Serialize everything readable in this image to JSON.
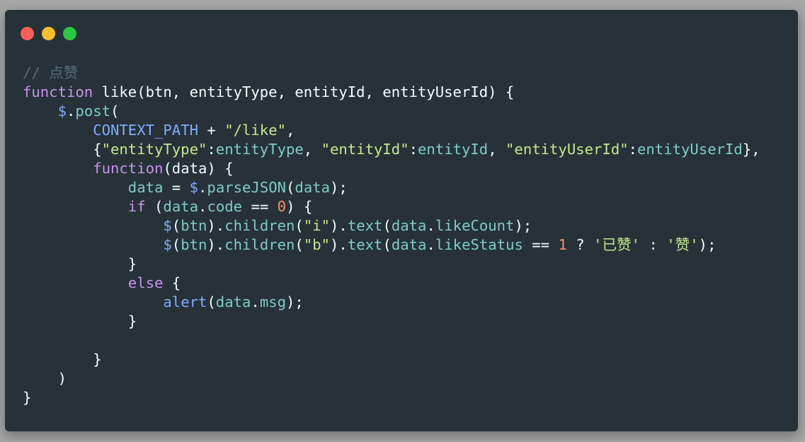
{
  "window": {
    "dots": [
      "close",
      "minimize",
      "maximize"
    ]
  },
  "colors": {
    "background": "#263238",
    "comment": "#546e7a",
    "keyword": "#c792ea",
    "function": "#82aaff",
    "string": "#c3e88d",
    "number": "#f78c6c",
    "property": "#80cbc4",
    "plain": "#eeffff"
  },
  "code": {
    "lines": [
      [
        [
          "comment",
          "// 点赞"
        ]
      ],
      [
        [
          "keyword",
          "function"
        ],
        [
          "plain",
          " like(btn, entityType, entityId, entityUserId) {"
        ]
      ],
      [
        [
          "plain",
          "    "
        ],
        [
          "fn",
          "$"
        ],
        [
          "plain",
          "."
        ],
        [
          "prop",
          "post"
        ],
        [
          "plain",
          "("
        ]
      ],
      [
        [
          "plain",
          "        "
        ],
        [
          "const",
          "CONTEXT_PATH"
        ],
        [
          "plain",
          " + "
        ],
        [
          "string",
          "\"/like\""
        ],
        [
          "plain",
          ","
        ]
      ],
      [
        [
          "plain",
          "        {"
        ],
        [
          "string",
          "\"entityType\""
        ],
        [
          "plain",
          ":"
        ],
        [
          "prop",
          "entityType"
        ],
        [
          "plain",
          ", "
        ],
        [
          "string",
          "\"entityId\""
        ],
        [
          "plain",
          ":"
        ],
        [
          "prop",
          "entityId"
        ],
        [
          "plain",
          ", "
        ],
        [
          "string",
          "\"entityUserId\""
        ],
        [
          "plain",
          ":"
        ],
        [
          "prop",
          "entityUserId"
        ],
        [
          "plain",
          "},"
        ]
      ],
      [
        [
          "plain",
          "        "
        ],
        [
          "keyword",
          "function"
        ],
        [
          "plain",
          "(data) {"
        ]
      ],
      [
        [
          "plain",
          "            "
        ],
        [
          "prop",
          "data"
        ],
        [
          "plain",
          " = "
        ],
        [
          "fn",
          "$"
        ],
        [
          "plain",
          "."
        ],
        [
          "prop",
          "parseJSON"
        ],
        [
          "plain",
          "("
        ],
        [
          "prop",
          "data"
        ],
        [
          "plain",
          ");"
        ]
      ],
      [
        [
          "plain",
          "            "
        ],
        [
          "keyword",
          "if"
        ],
        [
          "plain",
          " ("
        ],
        [
          "prop",
          "data"
        ],
        [
          "plain",
          "."
        ],
        [
          "prop",
          "code"
        ],
        [
          "plain",
          " == "
        ],
        [
          "number",
          "0"
        ],
        [
          "plain",
          ") {"
        ]
      ],
      [
        [
          "plain",
          "                "
        ],
        [
          "fn",
          "$"
        ],
        [
          "plain",
          "("
        ],
        [
          "prop",
          "btn"
        ],
        [
          "plain",
          ")."
        ],
        [
          "prop",
          "children"
        ],
        [
          "plain",
          "("
        ],
        [
          "string",
          "\"i\""
        ],
        [
          "plain",
          ")."
        ],
        [
          "prop",
          "text"
        ],
        [
          "plain",
          "("
        ],
        [
          "prop",
          "data"
        ],
        [
          "plain",
          "."
        ],
        [
          "prop",
          "likeCount"
        ],
        [
          "plain",
          ");"
        ]
      ],
      [
        [
          "plain",
          "                "
        ],
        [
          "fn",
          "$"
        ],
        [
          "plain",
          "("
        ],
        [
          "prop",
          "btn"
        ],
        [
          "plain",
          ")."
        ],
        [
          "prop",
          "children"
        ],
        [
          "plain",
          "("
        ],
        [
          "string",
          "\"b\""
        ],
        [
          "plain",
          ")."
        ],
        [
          "prop",
          "text"
        ],
        [
          "plain",
          "("
        ],
        [
          "prop",
          "data"
        ],
        [
          "plain",
          "."
        ],
        [
          "prop",
          "likeStatus"
        ],
        [
          "plain",
          " == "
        ],
        [
          "number",
          "1"
        ],
        [
          "plain",
          " ? "
        ],
        [
          "string",
          "'已赞'"
        ],
        [
          "plain",
          " : "
        ],
        [
          "string",
          "'赞'"
        ],
        [
          "plain",
          ");"
        ]
      ],
      [
        [
          "plain",
          "            }"
        ]
      ],
      [
        [
          "plain",
          "            "
        ],
        [
          "keyword",
          "else"
        ],
        [
          "plain",
          " {"
        ]
      ],
      [
        [
          "plain",
          "                "
        ],
        [
          "fn",
          "alert"
        ],
        [
          "plain",
          "("
        ],
        [
          "prop",
          "data"
        ],
        [
          "plain",
          "."
        ],
        [
          "prop",
          "msg"
        ],
        [
          "plain",
          ");"
        ]
      ],
      [
        [
          "plain",
          "            }"
        ]
      ],
      [
        [
          "plain",
          ""
        ]
      ],
      [
        [
          "plain",
          "        }"
        ]
      ],
      [
        [
          "plain",
          "    )"
        ]
      ],
      [
        [
          "plain",
          "}"
        ]
      ]
    ]
  }
}
